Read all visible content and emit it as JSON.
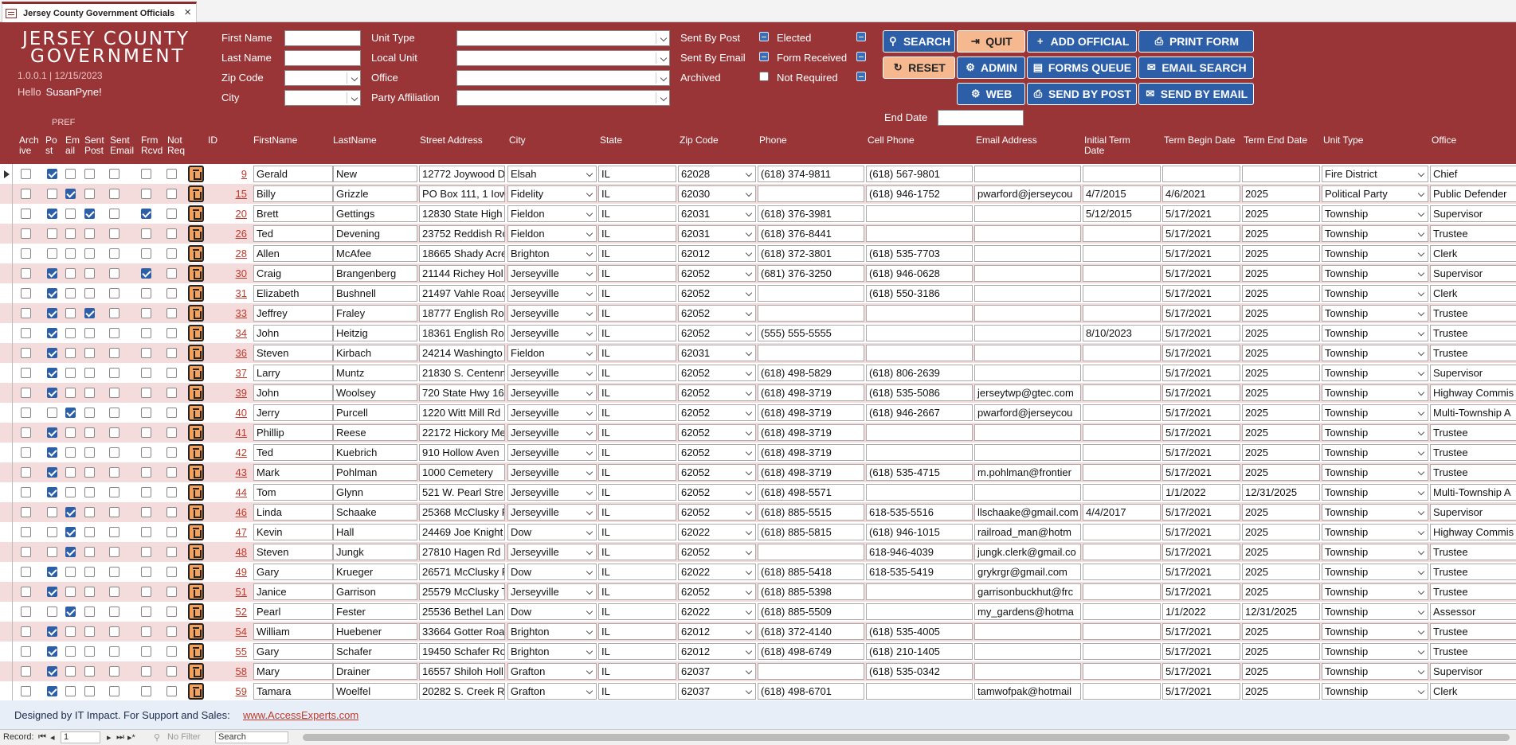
{
  "window": {
    "tab_title": "Jersey County Government Officials",
    "close": "×"
  },
  "logo": {
    "line1": "JERSEY COUNTY",
    "line2": "GOVERNMENT"
  },
  "version": "1.0.0.1 | 12/15/2023",
  "greeting": {
    "hello": "Hello",
    "user": "SusanPyne!"
  },
  "filters": {
    "first_name": "First Name",
    "last_name": "Last Name",
    "zip_code": "Zip Code",
    "city": "City",
    "unit_type": "Unit Type",
    "local_unit": "Local Unit",
    "office": "Office",
    "party_affiliation": "Party Affiliation",
    "sent_by_post": "Sent By Post",
    "sent_by_email": "Sent By Email",
    "archived": "Archived",
    "elected": "Elected",
    "form_received": "Form Received",
    "not_required": "Not Required",
    "end_date": "End Date"
  },
  "buttons": {
    "search": "SEARCH",
    "quit": "QUIT",
    "add_official": "ADD OFFICIAL",
    "print_form": "PRINT FORM",
    "reset": "RESET",
    "admin": "ADMIN",
    "forms_queue": "FORMS QUEUE",
    "email_search": "EMAIL SEARCH",
    "web": "WEB",
    "send_by_post": "SEND BY POST",
    "send_by_email": "SEND BY EMAIL"
  },
  "pref_label": "PREF",
  "columns": {
    "archive": [
      "Arch",
      "ive"
    ],
    "post": [
      "Po",
      "st"
    ],
    "email": [
      "Em",
      "ail"
    ],
    "sent_post": [
      "Sent",
      "Post"
    ],
    "sent_email": [
      "Sent",
      "Email"
    ],
    "frm_rcvd": [
      "Frm",
      "Rcvd"
    ],
    "not_req": [
      "Not",
      "Req"
    ],
    "id": "ID",
    "first_name": "FirstName",
    "last_name": "LastName",
    "street": "Street Address",
    "city": "City",
    "state": "State",
    "zip": "Zip Code",
    "phone": "Phone",
    "cell": "Cell Phone",
    "email_addr": "Email Address",
    "initial_term": [
      "Initial Term",
      "Date"
    ],
    "term_begin": "Term Begin Date",
    "term_end": "Term End Date",
    "unit_type": "Unit Type",
    "office": "Office"
  },
  "rows": [
    {
      "ar": 0,
      "po": 1,
      "em": 0,
      "sp": 0,
      "se": 0,
      "fr": 0,
      "nr": 0,
      "id": "9",
      "first": "Gerald",
      "last": "New",
      "street": "12772 Joywood D",
      "city": "Elsah",
      "state": "IL",
      "zip": "62028",
      "phone": "(618) 374-9811",
      "cell": "(618) 567-9801",
      "email": "",
      "initial": "",
      "begin": "",
      "end": "",
      "unit": "Fire District",
      "office": "Chief"
    },
    {
      "ar": 0,
      "po": 0,
      "em": 1,
      "sp": 0,
      "se": 0,
      "fr": 0,
      "nr": 0,
      "id": "15",
      "first": "Billy",
      "last": "Grizzle",
      "street": "PO Box 111, 1 Iow",
      "city": "Fidelity",
      "state": "IL",
      "zip": "62030",
      "phone": "",
      "cell": "(618) 946-1752",
      "email": "pwarford@jerseycou",
      "initial": "4/7/2015",
      "begin": "4/6/2021",
      "end": "2025",
      "unit": "Political Party",
      "office": "Public Defender"
    },
    {
      "ar": 0,
      "po": 1,
      "em": 0,
      "sp": 1,
      "se": 0,
      "fr": 1,
      "nr": 0,
      "id": "20",
      "first": "Brett",
      "last": "Gettings",
      "street": "12830 State High",
      "city": "Fieldon",
      "state": "IL",
      "zip": "62031",
      "phone": "(618) 376-3981",
      "cell": "",
      "email": "",
      "initial": "5/12/2015",
      "begin": "5/17/2021",
      "end": "2025",
      "unit": "Township",
      "office": "Supervisor"
    },
    {
      "ar": 0,
      "po": 0,
      "em": 0,
      "sp": 0,
      "se": 0,
      "fr": 0,
      "nr": 0,
      "id": "26",
      "first": "Ted",
      "last": "Devening",
      "street": "23752 Reddish Ro",
      "city": "Fieldon",
      "state": "IL",
      "zip": "62031",
      "phone": "(618) 376-8441",
      "cell": "",
      "email": "",
      "initial": "",
      "begin": "5/17/2021",
      "end": "2025",
      "unit": "Township",
      "office": "Trustee"
    },
    {
      "ar": 0,
      "po": 0,
      "em": 0,
      "sp": 0,
      "se": 0,
      "fr": 0,
      "nr": 0,
      "id": "28",
      "first": "Allen",
      "last": "McAfee",
      "street": "18665 Shady Acre",
      "city": "Brighton",
      "state": "IL",
      "zip": "62012",
      "phone": "(618) 372-3801",
      "cell": "(618) 535-7703",
      "email": "",
      "initial": "",
      "begin": "5/17/2021",
      "end": "2025",
      "unit": "Township",
      "office": "Clerk"
    },
    {
      "ar": 0,
      "po": 1,
      "em": 0,
      "sp": 0,
      "se": 0,
      "fr": 1,
      "nr": 0,
      "id": "30",
      "first": "Craig",
      "last": "Brangenberg",
      "street": "21144 Richey Hol",
      "city": "Jerseyville",
      "state": "IL",
      "zip": "62052",
      "phone": "(681) 376-3250",
      "cell": "(618) 946-0628",
      "email": "",
      "initial": "",
      "begin": "5/17/2021",
      "end": "2025",
      "unit": "Township",
      "office": "Supervisor"
    },
    {
      "ar": 0,
      "po": 1,
      "em": 0,
      "sp": 0,
      "se": 0,
      "fr": 0,
      "nr": 0,
      "id": "31",
      "first": "Elizabeth",
      "last": "Bushnell",
      "street": "21497 Vahle Road",
      "city": "Jerseyville",
      "state": "IL",
      "zip": "62052",
      "phone": "",
      "cell": "(618) 550-3186",
      "email": "",
      "initial": "",
      "begin": "5/17/2021",
      "end": "2025",
      "unit": "Township",
      "office": "Clerk"
    },
    {
      "ar": 0,
      "po": 1,
      "em": 0,
      "sp": 1,
      "se": 0,
      "fr": 0,
      "nr": 0,
      "id": "33",
      "first": "Jeffrey",
      "last": "Fraley",
      "street": "18777 English Roa",
      "city": "Jerseyville",
      "state": "IL",
      "zip": "62052",
      "phone": "",
      "cell": "",
      "email": "",
      "initial": "",
      "begin": "5/17/2021",
      "end": "2025",
      "unit": "Township",
      "office": "Trustee"
    },
    {
      "ar": 0,
      "po": 1,
      "em": 0,
      "sp": 0,
      "se": 0,
      "fr": 0,
      "nr": 0,
      "id": "34",
      "first": "John",
      "last": "Heitzig",
      "street": "18361 English Roa",
      "city": "Jerseyville",
      "state": "IL",
      "zip": "62052",
      "phone": "(555) 555-5555",
      "cell": "",
      "email": "",
      "initial": "8/10/2023",
      "begin": "5/17/2021",
      "end": "2025",
      "unit": "Township",
      "office": "Trustee"
    },
    {
      "ar": 0,
      "po": 1,
      "em": 0,
      "sp": 0,
      "se": 0,
      "fr": 0,
      "nr": 0,
      "id": "36",
      "first": "Steven",
      "last": "Kirbach",
      "street": "24214 Washingto",
      "city": "Fieldon",
      "state": "IL",
      "zip": "62031",
      "phone": "",
      "cell": "",
      "email": "",
      "initial": "",
      "begin": "5/17/2021",
      "end": "2025",
      "unit": "Township",
      "office": "Trustee"
    },
    {
      "ar": 0,
      "po": 1,
      "em": 0,
      "sp": 0,
      "se": 0,
      "fr": 0,
      "nr": 0,
      "id": "37",
      "first": "Larry",
      "last": "Muntz",
      "street": "21830 S. Centenn",
      "city": "Jerseyville",
      "state": "IL",
      "zip": "62052",
      "phone": "(618) 498-5829",
      "cell": "(618) 806-2639",
      "email": "",
      "initial": "",
      "begin": "5/17/2021",
      "end": "2025",
      "unit": "Township",
      "office": "Supervisor"
    },
    {
      "ar": 0,
      "po": 1,
      "em": 0,
      "sp": 0,
      "se": 0,
      "fr": 0,
      "nr": 0,
      "id": "39",
      "first": "John",
      "last": "Woolsey",
      "street": "720 State Hwy 16",
      "city": "Jerseyville",
      "state": "IL",
      "zip": "62052",
      "phone": "(618) 498-3719",
      "cell": "(618) 535-5086",
      "email": "jerseytwp@gtec.com",
      "initial": "",
      "begin": "5/17/2021",
      "end": "2025",
      "unit": "Township",
      "office": "Highway Commis"
    },
    {
      "ar": 0,
      "po": 0,
      "em": 1,
      "sp": 0,
      "se": 0,
      "fr": 0,
      "nr": 0,
      "id": "40",
      "first": "Jerry",
      "last": "Purcell",
      "street": "1220 Witt Mill Rd",
      "city": "Jerseyville",
      "state": "IL",
      "zip": "62052",
      "phone": "(618) 498-3719",
      "cell": "(618) 946-2667",
      "email": "pwarford@jerseycou",
      "initial": "",
      "begin": "5/17/2021",
      "end": "2025",
      "unit": "Township",
      "office": "Multi-Township A"
    },
    {
      "ar": 0,
      "po": 1,
      "em": 0,
      "sp": 0,
      "se": 0,
      "fr": 0,
      "nr": 0,
      "id": "41",
      "first": "Phillip",
      "last": "Reese",
      "street": "22172 Hickory Me",
      "city": "Jerseyville",
      "state": "IL",
      "zip": "62052",
      "phone": "(618) 498-3719",
      "cell": "",
      "email": "",
      "initial": "",
      "begin": "5/17/2021",
      "end": "2025",
      "unit": "Township",
      "office": "Trustee"
    },
    {
      "ar": 0,
      "po": 1,
      "em": 0,
      "sp": 0,
      "se": 0,
      "fr": 0,
      "nr": 0,
      "id": "42",
      "first": "Ted",
      "last": "Kuebrich",
      "street": "910 Hollow Aven",
      "city": "Jerseyville",
      "state": "IL",
      "zip": "62052",
      "phone": "(618) 498-3719",
      "cell": "",
      "email": "",
      "initial": "",
      "begin": "5/17/2021",
      "end": "2025",
      "unit": "Township",
      "office": "Trustee"
    },
    {
      "ar": 0,
      "po": 1,
      "em": 0,
      "sp": 0,
      "se": 0,
      "fr": 0,
      "nr": 0,
      "id": "43",
      "first": "Mark",
      "last": "Pohlman",
      "street": "1000 Cemetery",
      "city": "Jerseyville",
      "state": "IL",
      "zip": "62052",
      "phone": "(618) 498-3719",
      "cell": "(618) 535-4715",
      "email": "m.pohlman@frontier",
      "initial": "",
      "begin": "5/17/2021",
      "end": "2025",
      "unit": "Township",
      "office": "Trustee"
    },
    {
      "ar": 0,
      "po": 1,
      "em": 0,
      "sp": 0,
      "se": 0,
      "fr": 0,
      "nr": 0,
      "id": "44",
      "first": "Tom",
      "last": "Glynn",
      "street": "521 W. Pearl Stre",
      "city": "Jerseyville",
      "state": "IL",
      "zip": "62052",
      "phone": "(618) 498-5571",
      "cell": "",
      "email": "",
      "initial": "",
      "begin": "1/1/2022",
      "end": "12/31/2025",
      "unit": "Township",
      "office": "Multi-Township A"
    },
    {
      "ar": 0,
      "po": 0,
      "em": 1,
      "sp": 0,
      "se": 0,
      "fr": 0,
      "nr": 0,
      "id": "46",
      "first": "Linda",
      "last": "Schaake",
      "street": "25368 McClusky F",
      "city": "Jerseyville",
      "state": "IL",
      "zip": "62052",
      "phone": "(618) 885-5515",
      "cell": "618-535-5516",
      "email": "llschaake@gmail.com",
      "initial": "4/4/2017",
      "begin": "5/17/2021",
      "end": "2025",
      "unit": "Township",
      "office": "Supervisor"
    },
    {
      "ar": 0,
      "po": 0,
      "em": 1,
      "sp": 0,
      "se": 0,
      "fr": 0,
      "nr": 0,
      "id": "47",
      "first": "Kevin",
      "last": "Hall",
      "street": "24469 Joe Knight",
      "city": "Dow",
      "state": "IL",
      "zip": "62022",
      "phone": "(618) 885-5815",
      "cell": "(618) 946-1015",
      "email": "railroad_man@hotm",
      "initial": "",
      "begin": "5/17/2021",
      "end": "2025",
      "unit": "Township",
      "office": "Highway Commis"
    },
    {
      "ar": 0,
      "po": 0,
      "em": 1,
      "sp": 0,
      "se": 0,
      "fr": 0,
      "nr": 0,
      "id": "48",
      "first": "Steven",
      "last": "Jungk",
      "street": "27810 Hagen Rd",
      "city": "Jerseyville",
      "state": "IL",
      "zip": "62052",
      "phone": "",
      "cell": "618-946-4039",
      "email": "jungk.clerk@gmail.co",
      "initial": "",
      "begin": "5/17/2021",
      "end": "2025",
      "unit": "Township",
      "office": "Trustee"
    },
    {
      "ar": 0,
      "po": 1,
      "em": 0,
      "sp": 0,
      "se": 0,
      "fr": 0,
      "nr": 0,
      "id": "49",
      "first": "Gary",
      "last": "Krueger",
      "street": "26571 McClusky F",
      "city": "Dow",
      "state": "IL",
      "zip": "62022",
      "phone": "(618) 885-5418",
      "cell": "618-535-5419",
      "email": "grykrgr@gmail.com",
      "initial": "",
      "begin": "5/17/2021",
      "end": "2025",
      "unit": "Township",
      "office": "Trustee"
    },
    {
      "ar": 0,
      "po": 1,
      "em": 0,
      "sp": 0,
      "se": 0,
      "fr": 0,
      "nr": 0,
      "id": "51",
      "first": "Janice",
      "last": "Garrison",
      "street": "25579 McClusky T",
      "city": "Jerseyville",
      "state": "IL",
      "zip": "62052",
      "phone": "(618) 885-5398",
      "cell": "",
      "email": "garrisonbuckhut@frc",
      "initial": "",
      "begin": "5/17/2021",
      "end": "2025",
      "unit": "Township",
      "office": "Trustee"
    },
    {
      "ar": 0,
      "po": 0,
      "em": 1,
      "sp": 0,
      "se": 0,
      "fr": 0,
      "nr": 0,
      "id": "52",
      "first": "Pearl",
      "last": "Fester",
      "street": "25536 Bethel Lan",
      "city": "Dow",
      "state": "IL",
      "zip": "62022",
      "phone": "(618) 885-5509",
      "cell": "",
      "email": "my_gardens@hotma",
      "initial": "",
      "begin": "1/1/2022",
      "end": "12/31/2025",
      "unit": "Township",
      "office": "Assessor"
    },
    {
      "ar": 0,
      "po": 1,
      "em": 0,
      "sp": 0,
      "se": 0,
      "fr": 0,
      "nr": 0,
      "id": "54",
      "first": "William",
      "last": "Huebener",
      "street": "33664 Gotter Roa",
      "city": "Brighton",
      "state": "IL",
      "zip": "62012",
      "phone": "(618) 372-4140",
      "cell": "(618) 535-4005",
      "email": "",
      "initial": "",
      "begin": "5/17/2021",
      "end": "2025",
      "unit": "Township",
      "office": "Trustee"
    },
    {
      "ar": 0,
      "po": 1,
      "em": 0,
      "sp": 0,
      "se": 0,
      "fr": 0,
      "nr": 0,
      "id": "55",
      "first": "Gary",
      "last": "Schafer",
      "street": "19450 Schafer Ro",
      "city": "Brighton",
      "state": "IL",
      "zip": "62012",
      "phone": "(618) 498-6749",
      "cell": "(618) 210-1405",
      "email": "",
      "initial": "",
      "begin": "5/17/2021",
      "end": "2025",
      "unit": "Township",
      "office": "Trustee"
    },
    {
      "ar": 0,
      "po": 1,
      "em": 0,
      "sp": 0,
      "se": 0,
      "fr": 0,
      "nr": 0,
      "id": "58",
      "first": "Mary",
      "last": "Drainer",
      "street": "16557 Shiloh Holl",
      "city": "Grafton",
      "state": "IL",
      "zip": "62037",
      "phone": "",
      "cell": "(618) 535-0342",
      "email": "",
      "initial": "",
      "begin": "5/17/2021",
      "end": "2025",
      "unit": "Township",
      "office": "Supervisor"
    },
    {
      "ar": 0,
      "po": 1,
      "em": 0,
      "sp": 0,
      "se": 0,
      "fr": 0,
      "nr": 0,
      "id": "59",
      "first": "Tamara",
      "last": "Woelfel",
      "street": "20282 S. Creek Rc",
      "city": "Grafton",
      "state": "IL",
      "zip": "62037",
      "phone": "(618) 498-6701",
      "cell": "",
      "email": "tamwofpak@hotmail",
      "initial": "",
      "begin": "5/17/2021",
      "end": "2025",
      "unit": "Township",
      "office": "Clerk"
    }
  ],
  "footer": {
    "text": "Designed by IT Impact. For Support and Sales:",
    "link": "www.AccessExperts.com"
  },
  "nav": {
    "record_label": "Record:",
    "record_value": "1",
    "no_filter": "No Filter",
    "search": "Search"
  },
  "colors": {
    "header": "#9a3537",
    "button_blue": "#2d5fa8",
    "button_orange": "#f6b88f",
    "row_alt": "#f5dcdc"
  }
}
